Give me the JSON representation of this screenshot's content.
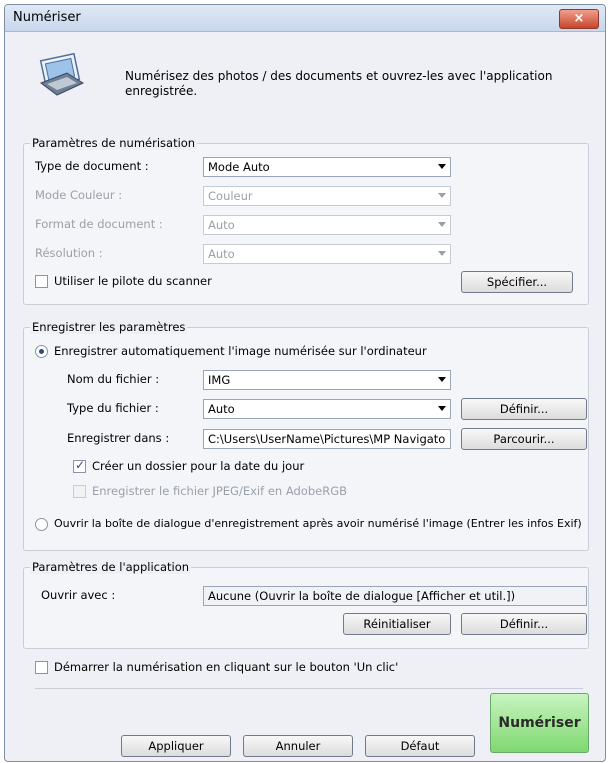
{
  "window": {
    "title": "Numériser",
    "close_label": "×"
  },
  "intro": {
    "text": "Numérisez des photos / des documents et ouvrez-les avec l'application enregistrée."
  },
  "scan_settings": {
    "title": "Paramètres de numérisation",
    "doc_type_label": "Type de document :",
    "doc_type_value": "Mode Auto",
    "color_mode_label": "Mode Couleur :",
    "color_mode_value": "Couleur",
    "doc_size_label": "Format de document :",
    "doc_size_value": "Auto",
    "resolution_label": "Résolution :",
    "resolution_value": "Auto",
    "use_driver_label": "Utiliser le pilote du scanner",
    "specify_button": "Spécifier..."
  },
  "save_settings": {
    "title": "Enregistrer les paramètres",
    "auto_save_label": "Enregistrer automatiquement l'image numérisée sur l'ordinateur",
    "file_name_label": "Nom du fichier :",
    "file_name_value": "IMG",
    "file_type_label": "Type du fichier :",
    "file_type_value": "Auto",
    "define_button": "Définir...",
    "save_in_label": "Enregistrer dans :",
    "save_in_value": "C:\\Users\\UserName\\Pictures\\MP Navigato",
    "browse_button": "Parcourir...",
    "create_folder_label": "Créer un dossier pour la date du jour",
    "jpeg_adobe_label": "Enregistrer le fichier JPEG/Exif en AdobeRGB",
    "open_dialog_label": "Ouvrir la boîte de dialogue d'enregistrement après avoir numérisé l'image (Entrer les infos Exif)"
  },
  "app_settings": {
    "title": "Paramètres de l'application",
    "open_with_label": "Ouvrir avec :",
    "open_with_value": "Aucune (Ouvrir la boîte de dialogue [Afficher et util.])",
    "reset_button": "Réinitialiser",
    "define_button": "Définir..."
  },
  "one_click_label": "Démarrer la numérisation en cliquant sur le bouton 'Un clic'",
  "footer": {
    "apply_button": "Appliquer",
    "cancel_button": "Annuler",
    "default_button": "Défaut",
    "scan_button": "Numériser"
  }
}
